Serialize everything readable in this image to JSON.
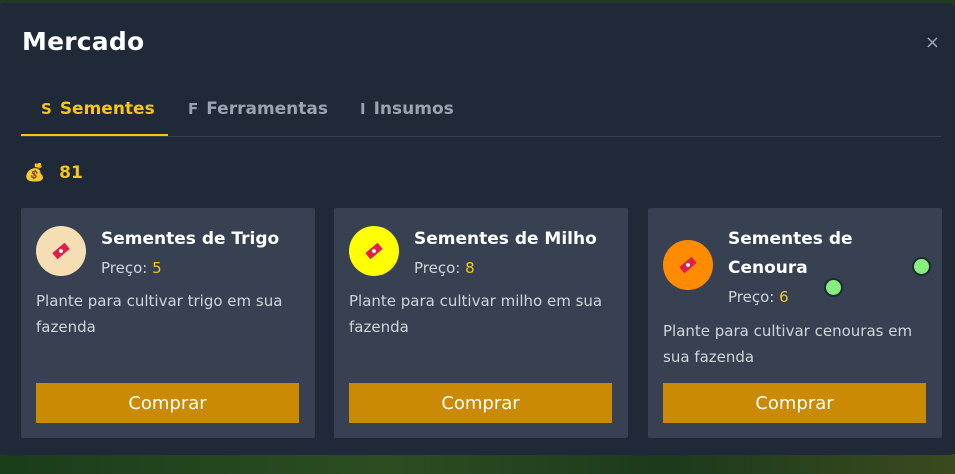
{
  "modal": {
    "title": "Mercado",
    "close_label": "×"
  },
  "tabs": [
    {
      "icon": "S",
      "label": "Sementes",
      "active": true
    },
    {
      "icon": "F",
      "label": "Ferramentas",
      "active": false
    },
    {
      "icon": "I",
      "label": "Insumos",
      "active": false
    }
  ],
  "wallet": {
    "icon": "money-bag-icon",
    "amount": "81"
  },
  "items": [
    {
      "name": "Sementes de Trigo",
      "price_label": "Preço:",
      "price": "5",
      "description": "Plante para cultivar trigo em sua fazenda",
      "buy_label": "Comprar",
      "icon_color": "#f5deb3",
      "icon": "seed-ticket-icon"
    },
    {
      "name": "Sementes de Milho",
      "price_label": "Preço:",
      "price": "8",
      "description": "Plante para cultivar milho em sua fazenda",
      "buy_label": "Comprar",
      "icon_color": "#ffff00",
      "icon": "seed-ticket-icon"
    },
    {
      "name": "Sementes de Cenoura",
      "price_label": "Preço:",
      "price": "6",
      "description": "Plante para cultivar cenouras em sua fazenda",
      "buy_label": "Comprar",
      "icon_color": "#ff8c00",
      "icon": "seed-ticket-icon"
    }
  ],
  "colors": {
    "accent": "#f5c518",
    "button": "#ca8a04",
    "panel": "#1f2937",
    "card": "#374151"
  }
}
